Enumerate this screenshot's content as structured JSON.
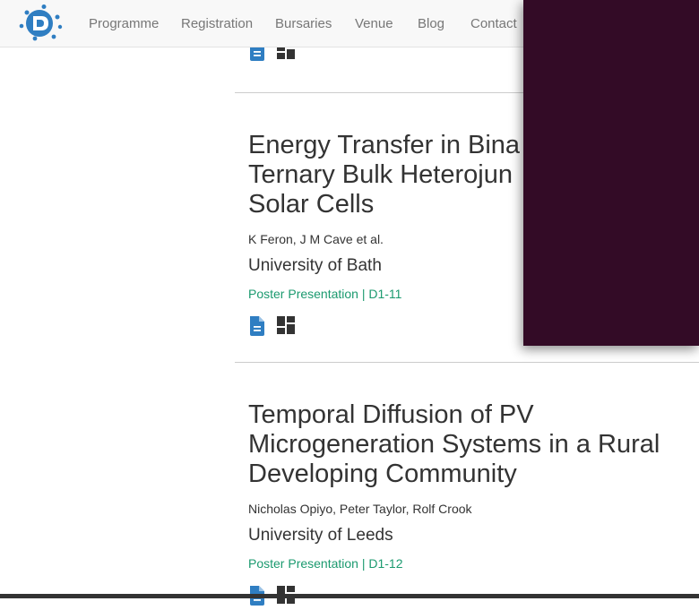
{
  "nav": {
    "logo_icon": "sun-logo-icon",
    "links": [
      "Programme",
      "Registration",
      "Bursaries",
      "Venue",
      "Blog",
      "Contact"
    ]
  },
  "articles": [
    {
      "title_lines": [
        "Energy Transfer in Bina",
        "Ternary Bulk Heterojun",
        "Solar Cells"
      ],
      "authors": "K Feron, J M Cave et al.",
      "affiliation": "University of Bath",
      "meta": "Poster Presentation | D1-11",
      "icons": [
        "document-icon",
        "poster-grid-icon"
      ]
    },
    {
      "title_lines": [
        "Temporal Diffusion of PV",
        "Microgeneration Systems in a Rural",
        "Developing Community"
      ],
      "authors": "Nicholas Opiyo, Peter Taylor, Rolf Crook",
      "affiliation": "University of Leeds",
      "meta": "Poster Presentation | D1-12",
      "icons": [
        "document-icon",
        "poster-grid-icon"
      ]
    }
  ],
  "colors": {
    "accent_green": "#1b9a6f",
    "icon_blue": "#2f7ec2",
    "panel": "#330b26"
  }
}
